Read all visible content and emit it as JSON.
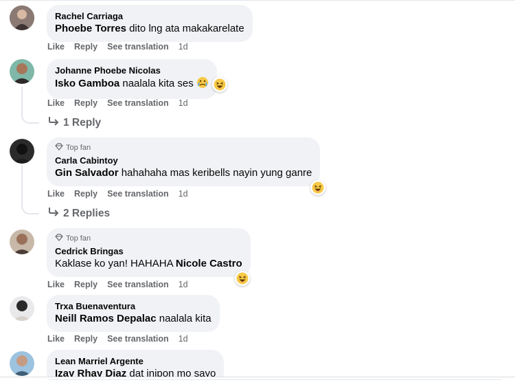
{
  "actions": {
    "like": "Like",
    "reply": "Reply",
    "translate": "See translation"
  },
  "comments": [
    {
      "author": "Rachel Carriaga",
      "mention": "Phoebe Torres",
      "text": " dito lng ata makakarelate",
      "time": "1d"
    },
    {
      "author": "Johanne Phoebe Nicolas",
      "mention": "Isko Gamboa",
      "text": " naalala kita ses",
      "time": "1d",
      "replies": "1 Reply"
    },
    {
      "badge": "Top fan",
      "author": "Carla Cabintoy",
      "mention": "Gin Salvador",
      "text": " hahahaha mas keribells nayin yung ganre",
      "time": "1d",
      "replies": "2 Replies"
    },
    {
      "badge": "Top fan",
      "author": "Cedrick Bringas",
      "text_before": "Kaklase ko yan! HAHAHA ",
      "mention": "Nicole Castro",
      "time": "1d"
    },
    {
      "author": "Trxa Buenaventura",
      "mention": "Neill Ramos Depalac",
      "text": " naalala kita",
      "time": "1d"
    },
    {
      "author": "Lean Marriel Argente",
      "mention": "Izay Rhay Diaz",
      "text": " dat inipon mo sayo"
    }
  ]
}
